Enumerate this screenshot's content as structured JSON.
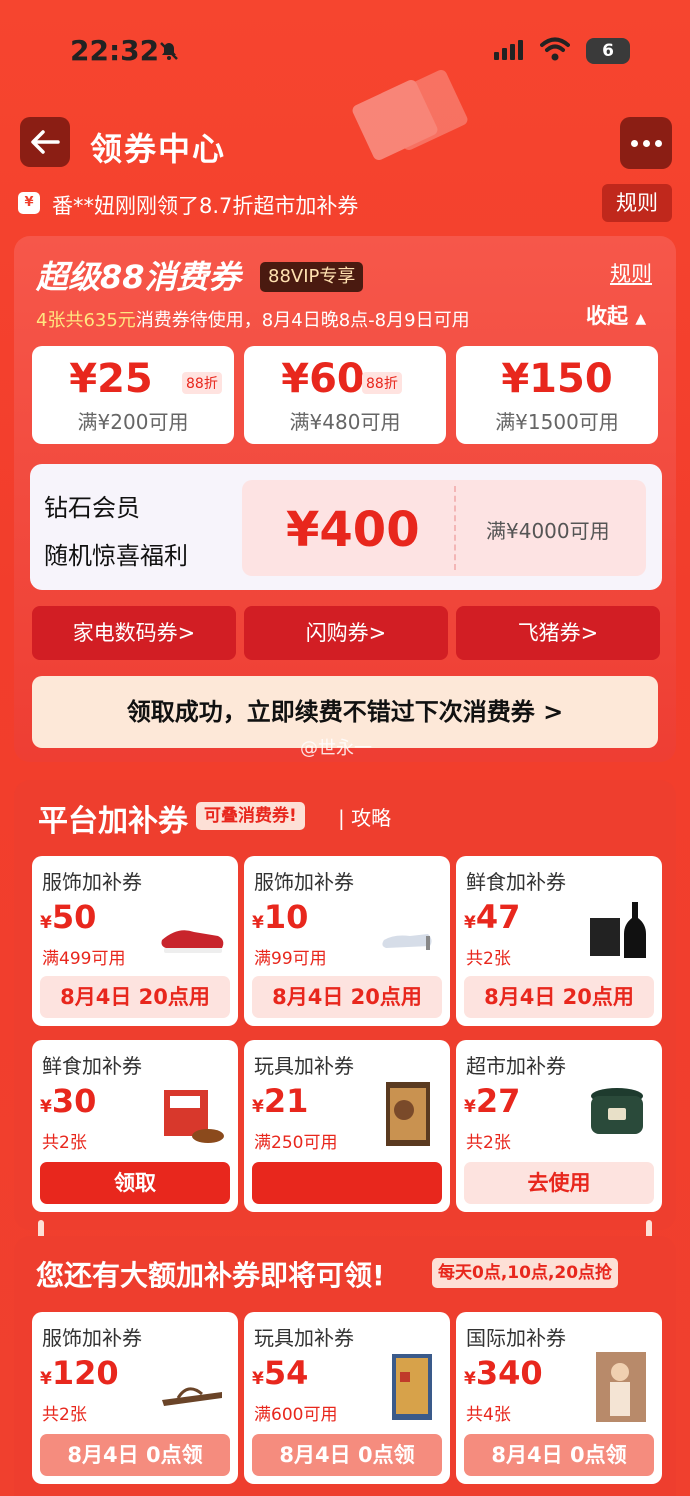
{
  "status": {
    "time": "22:32",
    "battery": "6"
  },
  "header": {
    "title": "领券中心"
  },
  "notice": {
    "icon": "¥",
    "text": "番**妞刚刚领了8.7折超市加补券",
    "rule": "规则"
  },
  "super88": {
    "title": "超级88消费券",
    "vip_badge": "88VIP专享",
    "rule": "规则",
    "subtitle_highlight": "4张共635元",
    "subtitle_rest": "消费券待使用，8月4日晚8点-8月9日可用",
    "collapse": "收起",
    "coupons": [
      {
        "amount": "¥25",
        "tag": "88折",
        "cond": "满¥200可用"
      },
      {
        "amount": "¥60",
        "tag": "88折",
        "cond": "满¥480可用"
      },
      {
        "amount": "¥150",
        "tag": "",
        "cond": "满¥1500可用"
      }
    ],
    "diamond": {
      "line1": "钻石会员",
      "line2": "随机惊喜福利",
      "amount": "¥400",
      "cond": "满¥4000可用"
    },
    "categories": [
      "家电数码券>",
      "闪购券>",
      "飞猪券>"
    ],
    "renew": "领取成功，立即续费不错过下次消费券 >"
  },
  "watermark": "@世永一",
  "platform": {
    "title": "平台加补券",
    "badge": "可叠消费券!",
    "guide": "| 攻略",
    "cards": [
      {
        "name": "服饰加补券",
        "amount": "50",
        "cond": "满499可用",
        "button": "8月4日 20点用"
      },
      {
        "name": "服饰加补券",
        "amount": "10",
        "cond": "满99可用",
        "button": "8月4日 20点用"
      },
      {
        "name": "鲜食加补券",
        "amount": "47",
        "cond": "共2张",
        "button": "8月4日 20点用"
      },
      {
        "name": "鲜食加补券",
        "amount": "30",
        "cond": "共2张",
        "button": "领取"
      },
      {
        "name": "玩具加补券",
        "amount": "21",
        "cond": "满250可用",
        "button": ""
      },
      {
        "name": "超市加补券",
        "amount": "27",
        "cond": "共2张",
        "button": "去使用"
      }
    ]
  },
  "upcoming": {
    "title": "您还有大额加补券即将可领!",
    "badge": "每天0点,10点,20点抢",
    "cards": [
      {
        "name": "服饰加补券",
        "amount": "120",
        "cond": "共2张",
        "button": "8月4日 0点领"
      },
      {
        "name": "玩具加补券",
        "amount": "54",
        "cond": "满600可用",
        "button": "8月4日 0点领"
      },
      {
        "name": "国际加补券",
        "amount": "340",
        "cond": "共4张",
        "button": "8月4日 0点领"
      }
    ]
  },
  "currency_symbol": "¥"
}
